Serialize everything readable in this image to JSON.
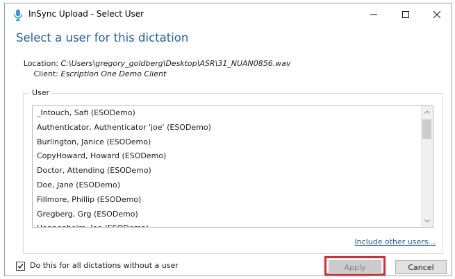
{
  "window": {
    "title": "InSync Upload - Select User",
    "icon": "microphone-icon",
    "controls": {
      "minimize": "minimize-icon",
      "maximize": "maximize-icon",
      "close": "close-icon"
    }
  },
  "heading": "Select a user for this dictation",
  "info": {
    "location_label": "Location:",
    "location_value": "C:\\Users\\gregory_goldberg\\Desktop\\ASR\\31_NUAN0856.wav",
    "client_label": "Client:",
    "client_value": "Escription One Demo Client"
  },
  "user_group": {
    "legend": "User",
    "items": [
      "_Intouch, Safi (ESODemo)",
      "Authenticator, Authenticator 'joe' (ESODemo)",
      "Burlington, Janice (ESODemo)",
      "CopyHoward, Howard (ESODemo)",
      "Doctor, Attending (ESODemo)",
      "Doe, Jane (ESODemo)",
      "Fillmore, Phillip (ESODemo)",
      "Gregberg, Grg (ESODemo)",
      "Hoppenheim, Joe (ESODemo)"
    ],
    "include_link": "Include other users..."
  },
  "footer": {
    "checkbox_label": "Do this for all dictations without a user",
    "checkbox_checked": true,
    "apply_label": "Apply",
    "cancel_label": "Cancel"
  },
  "colors": {
    "heading": "#1f5fa6",
    "link": "#1f5fa6",
    "highlight": "#e0262f",
    "icon": "#2e9bd6"
  }
}
